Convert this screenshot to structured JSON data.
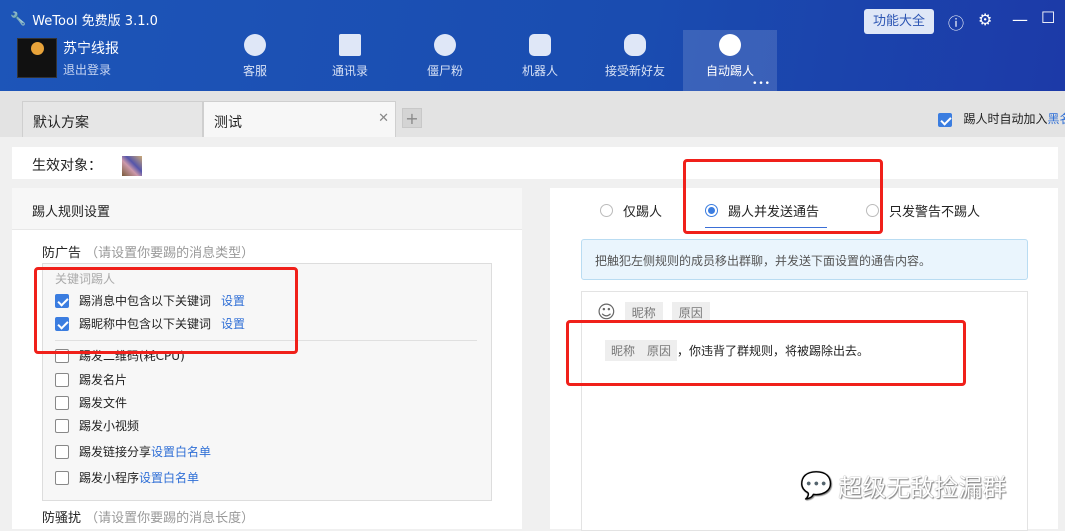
{
  "app": {
    "title": "WeTool 免费版 3.1.0"
  },
  "account": {
    "name": "苏宁线报",
    "logout": "退出登录"
  },
  "nav": [
    {
      "label": "客服",
      "icon": "headset-icon"
    },
    {
      "label": "通讯录",
      "icon": "contacts-icon"
    },
    {
      "label": "僵尸粉",
      "icon": "skull-icon"
    },
    {
      "label": "机器人",
      "icon": "robot-icon"
    },
    {
      "label": "接受新好友",
      "icon": "handshake-icon"
    },
    {
      "label": "自动踢人",
      "icon": "user-kick-icon",
      "active": true
    }
  ],
  "header": {
    "func_button": "功能大全",
    "more": "•••"
  },
  "tabs": [
    {
      "label": "默认方案"
    },
    {
      "label": "测试",
      "active": true
    }
  ],
  "options": {
    "auto_blacklist_prefix": "踢人时自动加入",
    "auto_blacklist_link": "黑名",
    "auto_blacklist_checked": true
  },
  "target": {
    "label": "生效对象："
  },
  "left": {
    "title": "踢人规则设置",
    "ad": {
      "title": "防广告",
      "hint": "（请设置你要踢的消息类型）",
      "keyword_group": "关键词踢人",
      "items": [
        {
          "label": "踢消息中包含以下关键词",
          "link": "设置",
          "checked": true
        },
        {
          "label": "踢昵称中包含以下关键词",
          "link": "设置",
          "checked": true
        },
        {
          "label": "踢发二维码(耗CPU)",
          "checked": false
        },
        {
          "label": "踢发名片",
          "checked": false
        },
        {
          "label": "踢发文件",
          "checked": false
        },
        {
          "label": "踢发小视频",
          "checked": false
        },
        {
          "label": "踢发链接分享",
          "link": "设置白名单",
          "checked": false
        },
        {
          "label": "踢发小程序",
          "link": "设置白名单",
          "checked": false
        }
      ]
    },
    "harass": {
      "title": "防骚扰",
      "hint": "（请设置你要踢的消息长度）"
    }
  },
  "right": {
    "modes": [
      {
        "label": "仅踢人",
        "selected": false
      },
      {
        "label": "踢人并发送通告",
        "selected": true
      },
      {
        "label": "只发警告不踢人",
        "selected": false
      }
    ],
    "info": "把触犯左侧规则的成员移出群聊，并发送下面设置的通告内容。",
    "toolbar": {
      "tag1": "昵称",
      "tag2": "原因"
    },
    "message": {
      "tag1": "昵称",
      "tag2": "原因",
      "text": "，你违背了群规则，将被踢除出去。"
    }
  },
  "watermark": "超级无敌捡漏群",
  "colors": {
    "header": "#1a4cb0",
    "accent": "#3b7de0",
    "annotation": "#f0201a"
  }
}
